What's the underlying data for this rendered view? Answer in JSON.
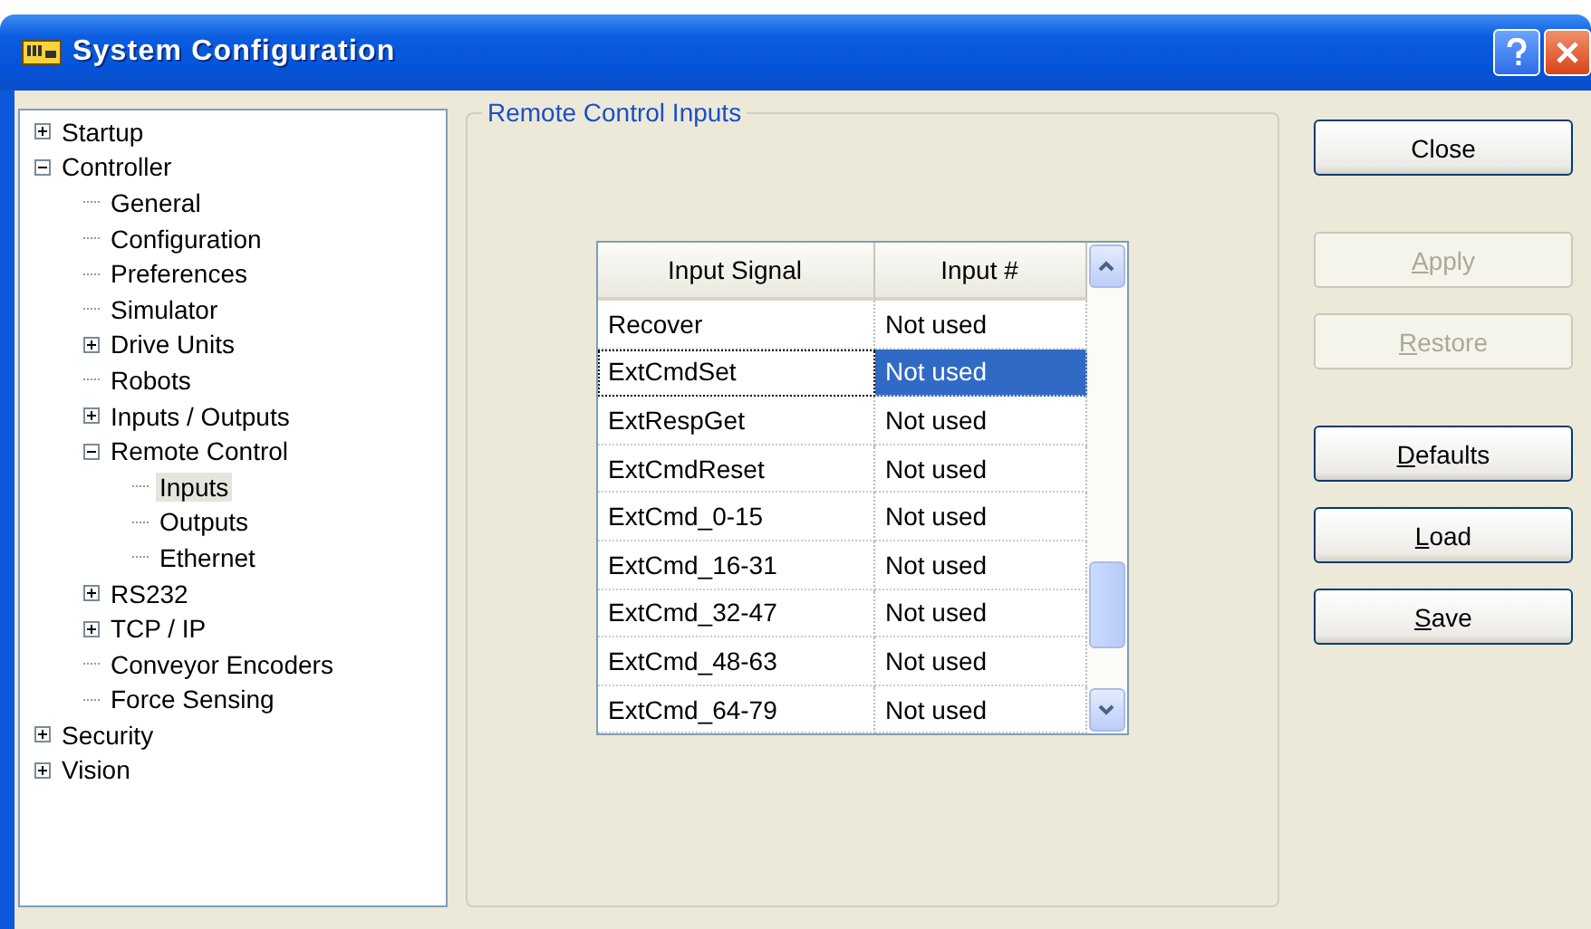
{
  "window": {
    "title": "System Configuration"
  },
  "tree": [
    {
      "label": "Startup",
      "expanded": false,
      "selected": false
    },
    {
      "label": "Controller",
      "expanded": true,
      "selected": false,
      "children": [
        {
          "label": "General",
          "selected": false
        },
        {
          "label": "Configuration",
          "selected": false
        },
        {
          "label": "Preferences",
          "selected": false
        },
        {
          "label": "Simulator",
          "selected": false
        },
        {
          "label": "Drive Units",
          "expanded": false,
          "selected": false
        },
        {
          "label": "Robots",
          "selected": false
        },
        {
          "label": "Inputs / Outputs",
          "expanded": false,
          "selected": false
        },
        {
          "label": "Remote Control",
          "expanded": true,
          "selected": false,
          "children": [
            {
              "label": "Inputs",
              "selected": true
            },
            {
              "label": "Outputs",
              "selected": false
            },
            {
              "label": "Ethernet",
              "selected": false
            }
          ]
        },
        {
          "label": "RS232",
          "expanded": false,
          "selected": false
        },
        {
          "label": "TCP / IP",
          "expanded": false,
          "selected": false
        },
        {
          "label": "Conveyor Encoders",
          "selected": false
        },
        {
          "label": "Force Sensing",
          "selected": false
        }
      ]
    },
    {
      "label": "Security",
      "expanded": false,
      "selected": false
    },
    {
      "label": "Vision",
      "expanded": false,
      "selected": false
    }
  ],
  "group": {
    "title": "Remote Control Inputs",
    "table": {
      "columns": [
        "Input Signal",
        "Input #"
      ],
      "rows": [
        {
          "cells": [
            "Recover",
            "Not used"
          ],
          "selected": false
        },
        {
          "cells": [
            "ExtCmdSet",
            "Not used"
          ],
          "selected": true
        },
        {
          "cells": [
            "ExtRespGet",
            "Not used"
          ],
          "selected": false
        },
        {
          "cells": [
            "ExtCmdReset",
            "Not used"
          ],
          "selected": false
        },
        {
          "cells": [
            "ExtCmd_0-15",
            "Not used"
          ],
          "selected": false
        },
        {
          "cells": [
            "ExtCmd_16-31",
            "Not used"
          ],
          "selected": false
        },
        {
          "cells": [
            "ExtCmd_32-47",
            "Not used"
          ],
          "selected": false
        },
        {
          "cells": [
            "ExtCmd_48-63",
            "Not used"
          ],
          "selected": false
        },
        {
          "cells": [
            "ExtCmd_64-79",
            "Not used"
          ],
          "selected": false
        }
      ]
    }
  },
  "button_groups": [
    [
      {
        "rest": "Close",
        "disabled": false
      }
    ],
    [
      {
        "key": "A",
        "rest": "pply",
        "disabled": true
      },
      {
        "key": "R",
        "rest": "estore",
        "disabled": true
      }
    ],
    [
      {
        "key": "D",
        "rest": "efaults",
        "disabled": false
      },
      {
        "key": "L",
        "rest": "oad",
        "disabled": false
      },
      {
        "key": "S",
        "rest": "ave",
        "disabled": false
      }
    ]
  ]
}
